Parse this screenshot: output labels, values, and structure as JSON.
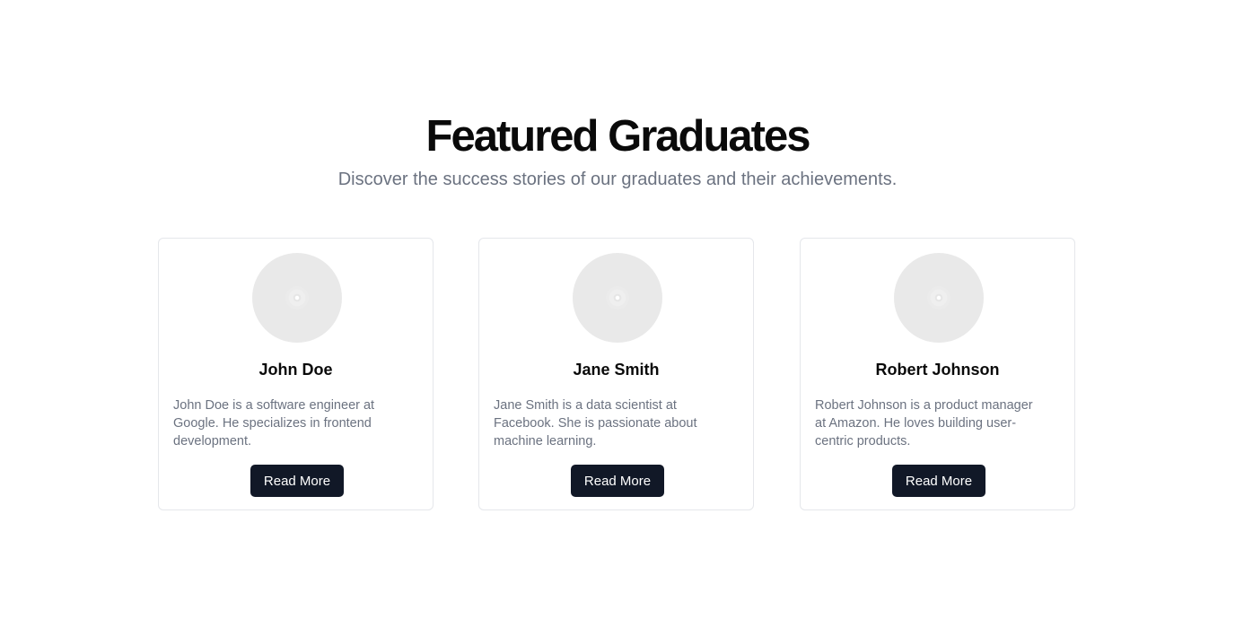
{
  "section": {
    "title": "Featured Graduates",
    "subtitle": "Discover the success stories of our graduates and their achievements."
  },
  "graduates": [
    {
      "name": "John Doe",
      "description": "John Doe is a software engineer at Google. He specializes in frontend development.",
      "button_label": "Read More",
      "avatar_icon": "image-placeholder-icon"
    },
    {
      "name": "Jane Smith",
      "description": "Jane Smith is a data scientist at Facebook. She is passionate about machine learning.",
      "button_label": "Read More",
      "avatar_icon": "image-placeholder-icon"
    },
    {
      "name": "Robert Johnson",
      "description": "Robert Johnson is a product manager at Amazon. He loves building user-centric products.",
      "button_label": "Read More",
      "avatar_icon": "image-placeholder-icon"
    }
  ],
  "colors": {
    "button_bg": "#111827",
    "muted_text": "#6b7280",
    "card_border": "#e5e7eb",
    "avatar_bg": "#e9e9e9"
  }
}
